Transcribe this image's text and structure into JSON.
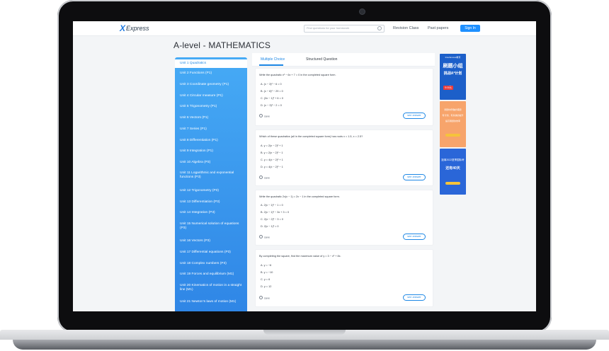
{
  "app": {
    "logo_mark": "X",
    "logo_text": "Express"
  },
  "topbar": {
    "search_placeholder": "Find questions for your homework",
    "nav": [
      "Revision Class",
      "Past papers"
    ],
    "signin_label": "Sign In"
  },
  "page": {
    "title": "A-level - MATHEMATICS"
  },
  "sidebar": {
    "items": [
      {
        "label": "Unit 1 Quadratics",
        "active": true
      },
      {
        "label": "Unit 2 Functions (P1)"
      },
      {
        "label": "Unit 3 Coordinate geometry (P1)"
      },
      {
        "label": "Unit 4 Circular measure (P1)"
      },
      {
        "label": "Unit 5 Trigonometry (P1)"
      },
      {
        "label": "Unit 6 Vectors (P1)"
      },
      {
        "label": "Unit 7 Series (P1)"
      },
      {
        "label": "Unit 8 Differentiation (P1)"
      },
      {
        "label": "Unit 9 Integration (P1)"
      },
      {
        "label": "Unit 10 Algebra (P3)"
      },
      {
        "label": "Unit 11 Logarithmic and exponential functions (P3)"
      },
      {
        "label": "Unit 12 Trigonometry (P3)"
      },
      {
        "label": "Unit 13 Differentiation (P3)"
      },
      {
        "label": "Unit 14 Integration (P3)"
      },
      {
        "label": "Unit 15 Numerical solution of equations (P3)"
      },
      {
        "label": "Unit 16 Vectors (P3)"
      },
      {
        "label": "Unit 17 Differential equations (P3)"
      },
      {
        "label": "Unit 18 Complex numbers (P3)"
      },
      {
        "label": "Unit 19 Forces and equilibrium (M1)"
      },
      {
        "label": "Unit 20 Kinematics of motion in a straight line (M1)"
      },
      {
        "label": "Unit 21 Newton's laws of motion (M1)"
      }
    ]
  },
  "tabs": [
    "Multiple Choice",
    "Structured Question"
  ],
  "questions": [
    {
      "text": "Write the quadratic x² − 6x + 7 = 0 in the completed square form.",
      "options": [
        "A.  (x − 3)² − 6 = 0",
        "B.  (x − 6)² − 29 = 0",
        "C.  (3x − 1)² + 6 = 0",
        "D.  (x − 3)² − 2 = 0"
      ],
      "save": "save",
      "see": "see answer"
    },
    {
      "text": "Which of these quadratics (all in the completed square form) has roots x = 1.5, x = 2.5?",
      "options": [
        "A.  y = 2(x − 2)² + 1",
        "B.  y = 2(x − 2)² − 1",
        "C.  y = 4(x − 2)² + 1",
        "D.  y = 4(x − 2)² − 1"
      ],
      "save": "save",
      "see": "see answer"
    },
    {
      "text": "Write the quadratic 2x(x − 1) = 2x − 1 in the completed square form.",
      "options": [
        "A.  2(x − 1)² − 1 = 0",
        "B.  2(x − 1)² − 3x + 3 = 0",
        "C.  2(x − 2)² − 3 = 0",
        "D.  2(x − 1)² = 0"
      ],
      "save": "save",
      "see": "see answer"
    },
    {
      "text": "By completing the square, find the maximum value of y = 3 − x² + 8x.",
      "options": [
        "A.  y = −6",
        "B.  y = −10",
        "C.  y = 6",
        "D.  y = 12"
      ],
      "save": "save",
      "see": "see answer"
    }
  ],
  "ads": [
    {
      "brand": "Interfamous教育",
      "headline": "刷题小组",
      "sub": "挑战A*计划",
      "price": "9.9元"
    },
    {
      "line1": "刷题中所做的错题",
      "line2": "有计划、有系统的提升",
      "line3": "提高刷题的效率"
    },
    {
      "line1": "距离2022夏季国际考",
      "line2": "还有40天"
    }
  ]
}
